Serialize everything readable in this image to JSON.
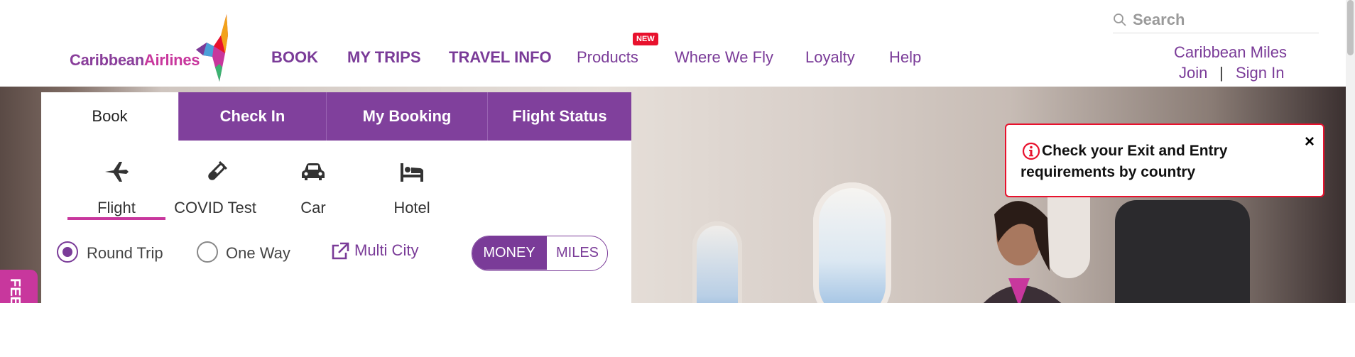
{
  "brand": {
    "logo_main": "Caribbean",
    "logo_second": "Airlines",
    "accent": "#7a3b98",
    "pink": "#c8379d",
    "alert_red": "#e8112d"
  },
  "nav": {
    "items": [
      "BOOK",
      "MY TRIPS",
      "TRAVEL INFO",
      "Products",
      "Where We Fly",
      "Loyalty",
      "Help"
    ],
    "new_badge": "NEW"
  },
  "search": {
    "placeholder": "Search"
  },
  "account": {
    "title": "Caribbean Miles",
    "join": "Join",
    "separator": "|",
    "sign_in": "Sign In"
  },
  "booking": {
    "tabs": [
      "Book",
      "Check In",
      "My Booking",
      "Flight Status"
    ],
    "active_tab": "Book",
    "sub_tabs": [
      {
        "label": "Flight",
        "icon": "plane-icon"
      },
      {
        "label": "COVID Test",
        "icon": "test-tube-icon"
      },
      {
        "label": "Car",
        "icon": "car-icon"
      },
      {
        "label": "Hotel",
        "icon": "bed-icon"
      }
    ],
    "active_sub_tab": "Flight",
    "trip_types": [
      "Round Trip",
      "One Way"
    ],
    "selected_trip_type": "Round Trip",
    "multi_city": "Multi City",
    "currency_toggle": [
      "MONEY",
      "MILES"
    ],
    "selected_currency": "MONEY"
  },
  "alert": {
    "text": "Check your Exit and Entry requirements by country",
    "close": "×"
  },
  "feedback_tab": "FEEDBACK"
}
